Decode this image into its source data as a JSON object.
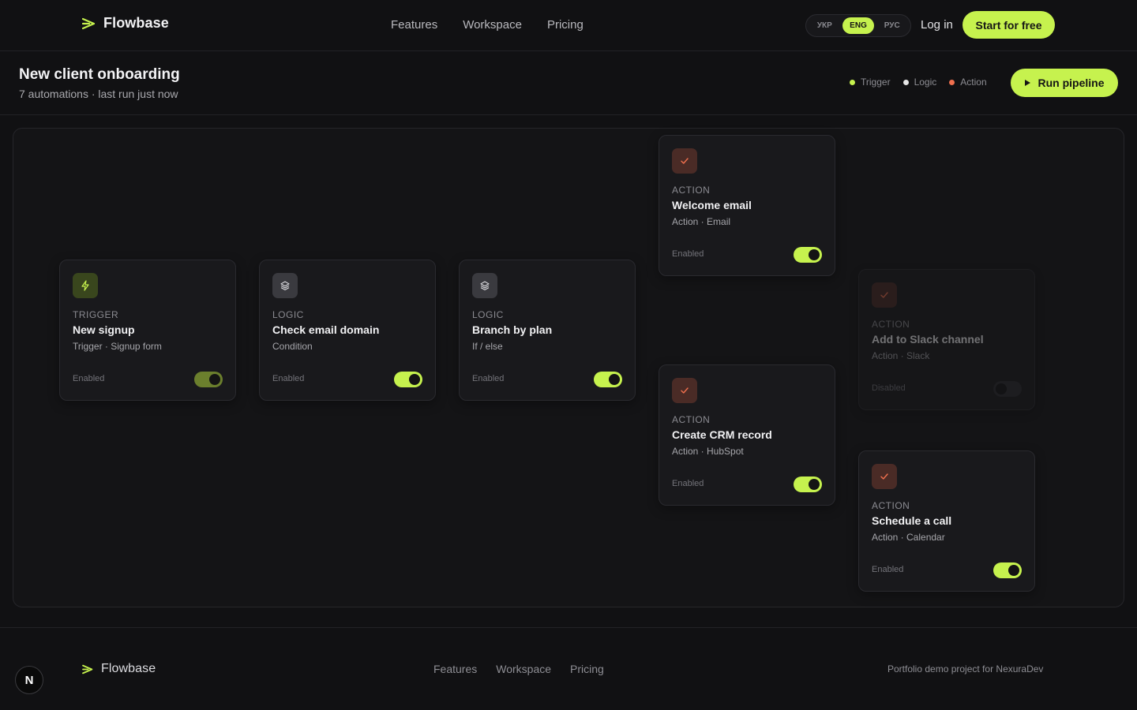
{
  "brand": {
    "name": "Flowbase",
    "accent": "#c6f24e"
  },
  "nav": {
    "links": [
      "Features",
      "Workspace",
      "Pricing"
    ]
  },
  "lang": {
    "options": [
      "УКР",
      "ENG",
      "РУС"
    ],
    "selected": "ENG"
  },
  "auth": {
    "login": "Log in",
    "cta": "Start for free"
  },
  "page": {
    "title": "New client onboarding",
    "subtitle": "7 automations · last run just now"
  },
  "legend": [
    {
      "label": "Trigger",
      "color": "#c6f24e"
    },
    {
      "label": "Logic",
      "color": "#e6e6e6"
    },
    {
      "label": "Action",
      "color": "#f0704e"
    }
  ],
  "run_button": "Run pipeline",
  "nodes": [
    {
      "kind": "TRIGGER",
      "icon": "bolt-icon",
      "title": "New signup",
      "subtitle": "Trigger · Signup form",
      "status": "Enabled",
      "enabled": true
    },
    {
      "kind": "LOGIC",
      "icon": "layers-icon",
      "title": "Check email domain",
      "subtitle": "Condition",
      "status": "Enabled",
      "enabled": true
    },
    {
      "kind": "LOGIC",
      "icon": "layers-icon",
      "title": "Branch by plan",
      "subtitle": "If / else",
      "status": "Enabled",
      "enabled": true
    },
    {
      "kind": "ACTION",
      "icon": "check-icon",
      "title": "Welcome email",
      "subtitle": "Action · Email",
      "status": "Enabled",
      "enabled": true
    },
    {
      "kind": "ACTION",
      "icon": "check-icon",
      "title": "Create CRM record",
      "subtitle": "Action · HubSpot",
      "status": "Enabled",
      "enabled": true
    },
    {
      "kind": "ACTION",
      "icon": "check-icon",
      "title": "Add to Slack channel",
      "subtitle": "Action · Slack",
      "status": "Disabled",
      "enabled": false
    },
    {
      "kind": "ACTION",
      "icon": "check-icon",
      "title": "Schedule a call",
      "subtitle": "Action · Calendar",
      "status": "Enabled",
      "enabled": true
    }
  ],
  "footer": {
    "brand": "Flowbase",
    "links": [
      "Features",
      "Workspace",
      "Pricing"
    ],
    "note": "Portfolio demo project for NexuraDev"
  },
  "badge": "N"
}
